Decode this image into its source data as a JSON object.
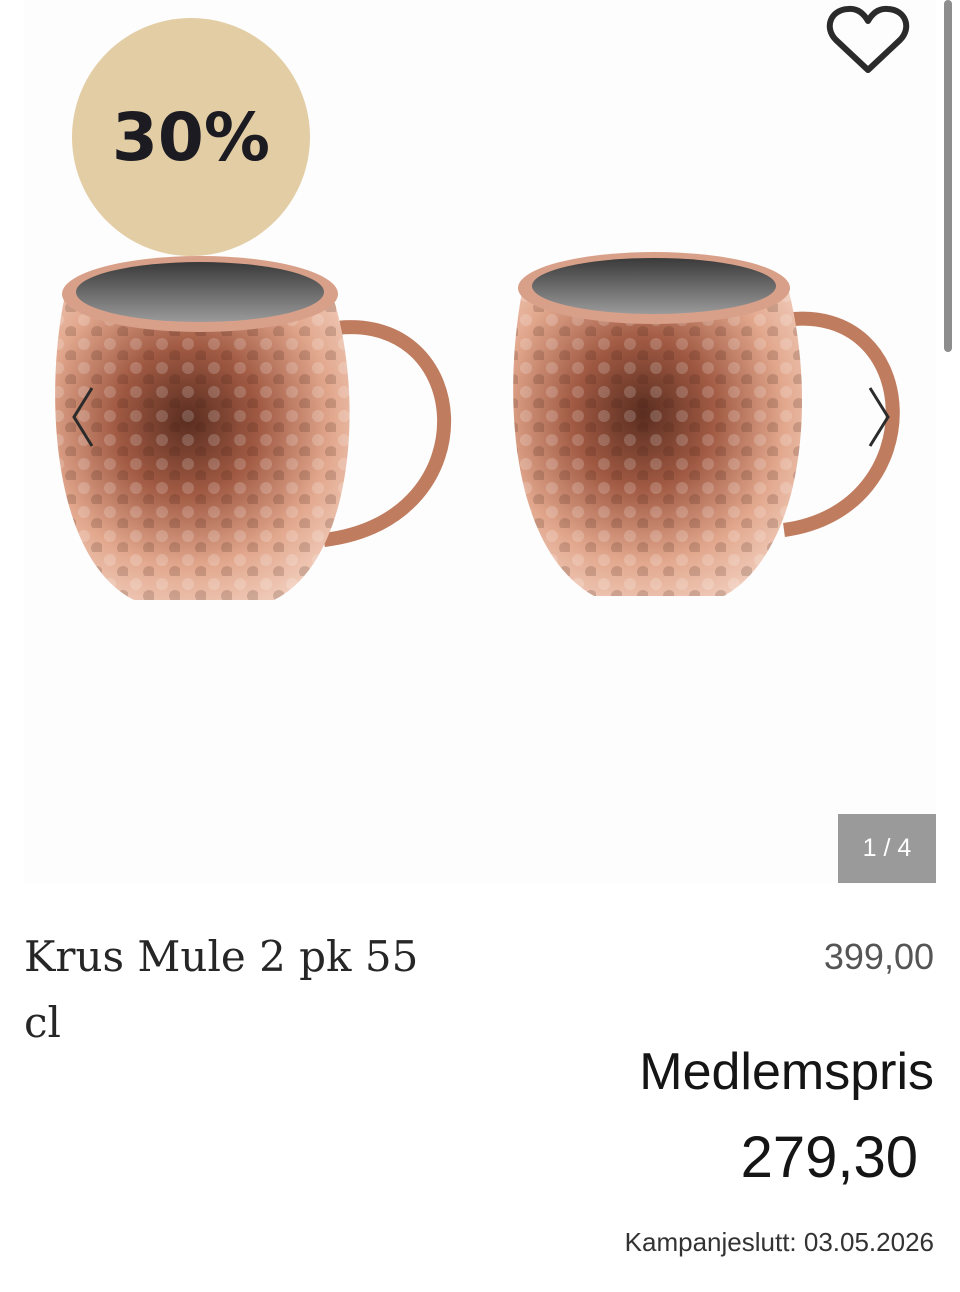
{
  "gallery": {
    "discount_badge": "30%",
    "counter": "1 / 4",
    "prev_icon": "chevron-left-icon",
    "next_icon": "chevron-right-icon",
    "favorite_icon": "heart-icon"
  },
  "product": {
    "title": "Krus Mule 2 pk 55 cl",
    "old_price": "399,00",
    "member_label": "Medlemspris",
    "member_price": "279,30",
    "campaign_end": "Kampanjeslutt: 03.05.2026"
  },
  "colors": {
    "badge": "#e3cda4",
    "counter_bg": "#9a9a9a",
    "copper": "#c98a6a"
  }
}
